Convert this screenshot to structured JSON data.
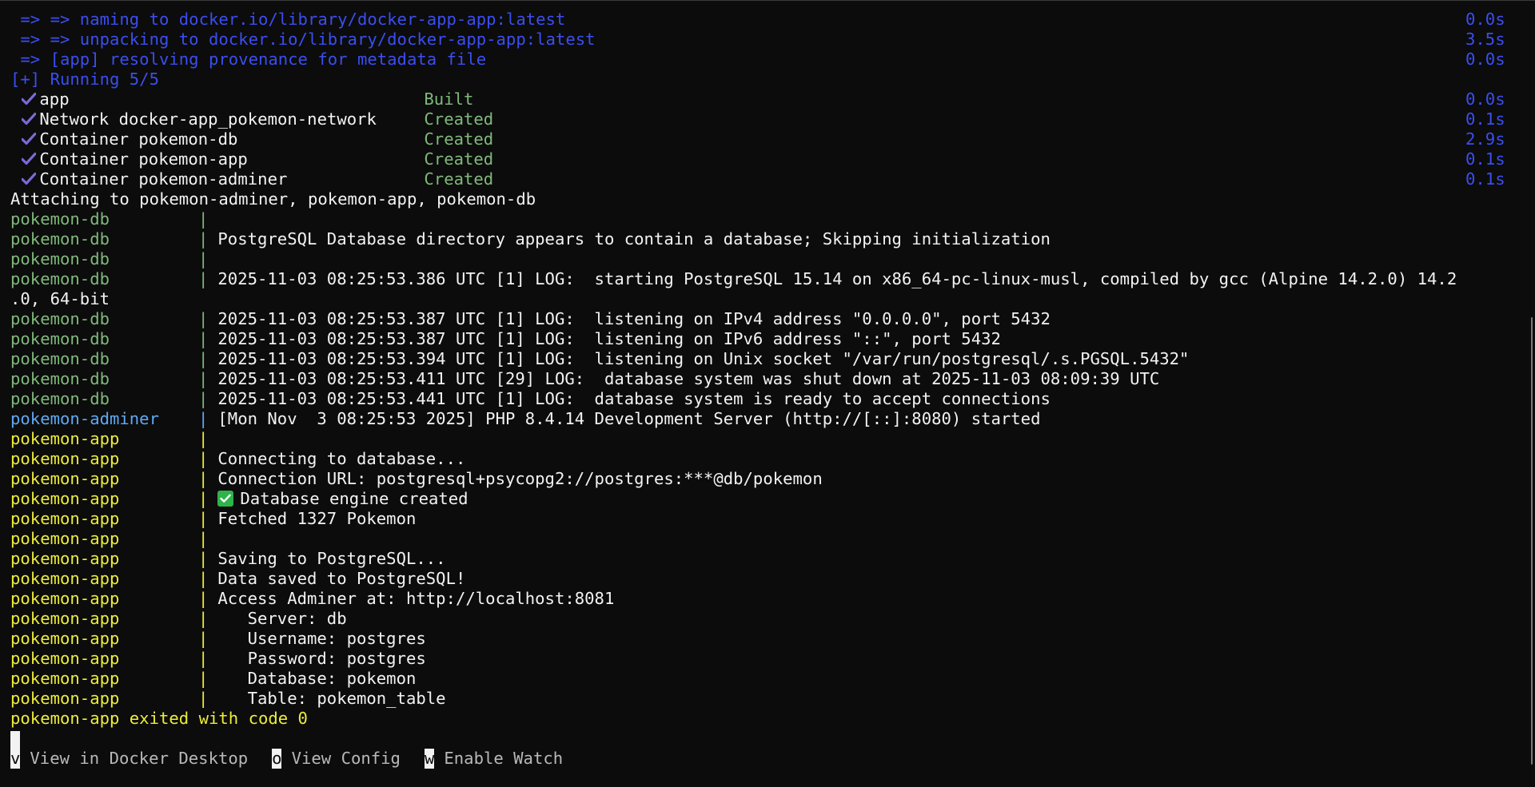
{
  "build_lines": [
    {
      "text": " => => naming to docker.io/library/docker-app-app:latest",
      "duration": "0.0s"
    },
    {
      "text": " => => unpacking to docker.io/library/docker-app-app:latest",
      "duration": "3.5s"
    },
    {
      "text": " => [app] resolving provenance for metadata file",
      "duration": "0.0s"
    }
  ],
  "running_header": "[+] Running 5/5",
  "status_items": [
    {
      "name": "app",
      "state": "Built",
      "duration": "0.0s"
    },
    {
      "name": "Network docker-app_pokemon-network",
      "state": "Created",
      "duration": "0.1s"
    },
    {
      "name": "Container pokemon-db",
      "state": "Created",
      "duration": "2.9s"
    },
    {
      "name": "Container pokemon-app",
      "state": "Created",
      "duration": "0.1s"
    },
    {
      "name": "Container pokemon-adminer",
      "state": "Created",
      "duration": "0.1s"
    }
  ],
  "attaching_line": "Attaching to pokemon-adminer, pokemon-app, pokemon-db",
  "logs": [
    {
      "service": "pokemon-db",
      "color": "#7fb87a",
      "message": ""
    },
    {
      "service": "pokemon-db",
      "color": "#7fb87a",
      "message": "PostgreSQL Database directory appears to contain a database; Skipping initialization"
    },
    {
      "service": "pokemon-db",
      "color": "#7fb87a",
      "message": ""
    },
    {
      "service": "pokemon-db",
      "color": "#7fb87a",
      "message": "2025-11-03 08:25:53.386 UTC [1] LOG:  starting PostgreSQL 15.14 on x86_64-pc-linux-musl, compiled by gcc (Alpine 14.2.0) 14.2",
      "wrap": ".0, 64-bit"
    },
    {
      "service": "pokemon-db",
      "color": "#7fb87a",
      "message": "2025-11-03 08:25:53.387 UTC [1] LOG:  listening on IPv4 address \"0.0.0.0\", port 5432"
    },
    {
      "service": "pokemon-db",
      "color": "#7fb87a",
      "message": "2025-11-03 08:25:53.387 UTC [1] LOG:  listening on IPv6 address \"::\", port 5432"
    },
    {
      "service": "pokemon-db",
      "color": "#7fb87a",
      "message": "2025-11-03 08:25:53.394 UTC [1] LOG:  listening on Unix socket \"/var/run/postgresql/.s.PGSQL.5432\""
    },
    {
      "service": "pokemon-db",
      "color": "#7fb87a",
      "message": "2025-11-03 08:25:53.411 UTC [29] LOG:  database system was shut down at 2025-11-03 08:09:39 UTC"
    },
    {
      "service": "pokemon-db",
      "color": "#7fb87a",
      "message": "2025-11-03 08:25:53.441 UTC [1] LOG:  database system is ready to accept connections"
    },
    {
      "service": "pokemon-adminer",
      "color": "#5ea9f5",
      "message": "[Mon Nov  3 08:25:53 2025] PHP 8.4.14 Development Server (http://[::]:8080) started"
    },
    {
      "service": "pokemon-app",
      "color": "#ecec3a",
      "message": ""
    },
    {
      "service": "pokemon-app",
      "color": "#ecec3a",
      "message": "Connecting to database..."
    },
    {
      "service": "pokemon-app",
      "color": "#ecec3a",
      "message": "Connection URL: postgresql+psycopg2://postgres:***@db/pokemon"
    },
    {
      "service": "pokemon-app",
      "color": "#ecec3a",
      "message": "Database engine created",
      "emoji": "check-mark-button"
    },
    {
      "service": "pokemon-app",
      "color": "#ecec3a",
      "message": "Fetched 1327 Pokemon"
    },
    {
      "service": "pokemon-app",
      "color": "#ecec3a",
      "message": ""
    },
    {
      "service": "pokemon-app",
      "color": "#ecec3a",
      "message": "Saving to PostgreSQL..."
    },
    {
      "service": "pokemon-app",
      "color": "#ecec3a",
      "message": "Data saved to PostgreSQL!"
    },
    {
      "service": "pokemon-app",
      "color": "#ecec3a",
      "message": "Access Adminer at: http://localhost:8081"
    },
    {
      "service": "pokemon-app",
      "color": "#ecec3a",
      "message": "   Server: db"
    },
    {
      "service": "pokemon-app",
      "color": "#ecec3a",
      "message": "   Username: postgres"
    },
    {
      "service": "pokemon-app",
      "color": "#ecec3a",
      "message": "   Password: postgres"
    },
    {
      "service": "pokemon-app",
      "color": "#ecec3a",
      "message": "   Database: pokemon"
    },
    {
      "service": "pokemon-app",
      "color": "#ecec3a",
      "message": "   Table: pokemon_table"
    }
  ],
  "exit_line": "pokemon-app exited with code 0",
  "menu": [
    {
      "key": "v",
      "label": " View in Docker Desktop",
      "name": "view-in-docker-desktop"
    },
    {
      "key": "o",
      "label": " View Config",
      "name": "view-config"
    },
    {
      "key": "w",
      "label": " Enable Watch",
      "name": "enable-watch"
    }
  ],
  "colors": {
    "background": "#0c0c0c",
    "build_blue": "#3b4ef0",
    "db_green": "#7fb87a",
    "app_yellow": "#ecec3a",
    "adminer_blue": "#5ea9f5",
    "check_purple": "#7a6ad8"
  },
  "icons": {
    "status_check": "check-mark-icon",
    "emoji": "check-mark-button-emoji"
  }
}
